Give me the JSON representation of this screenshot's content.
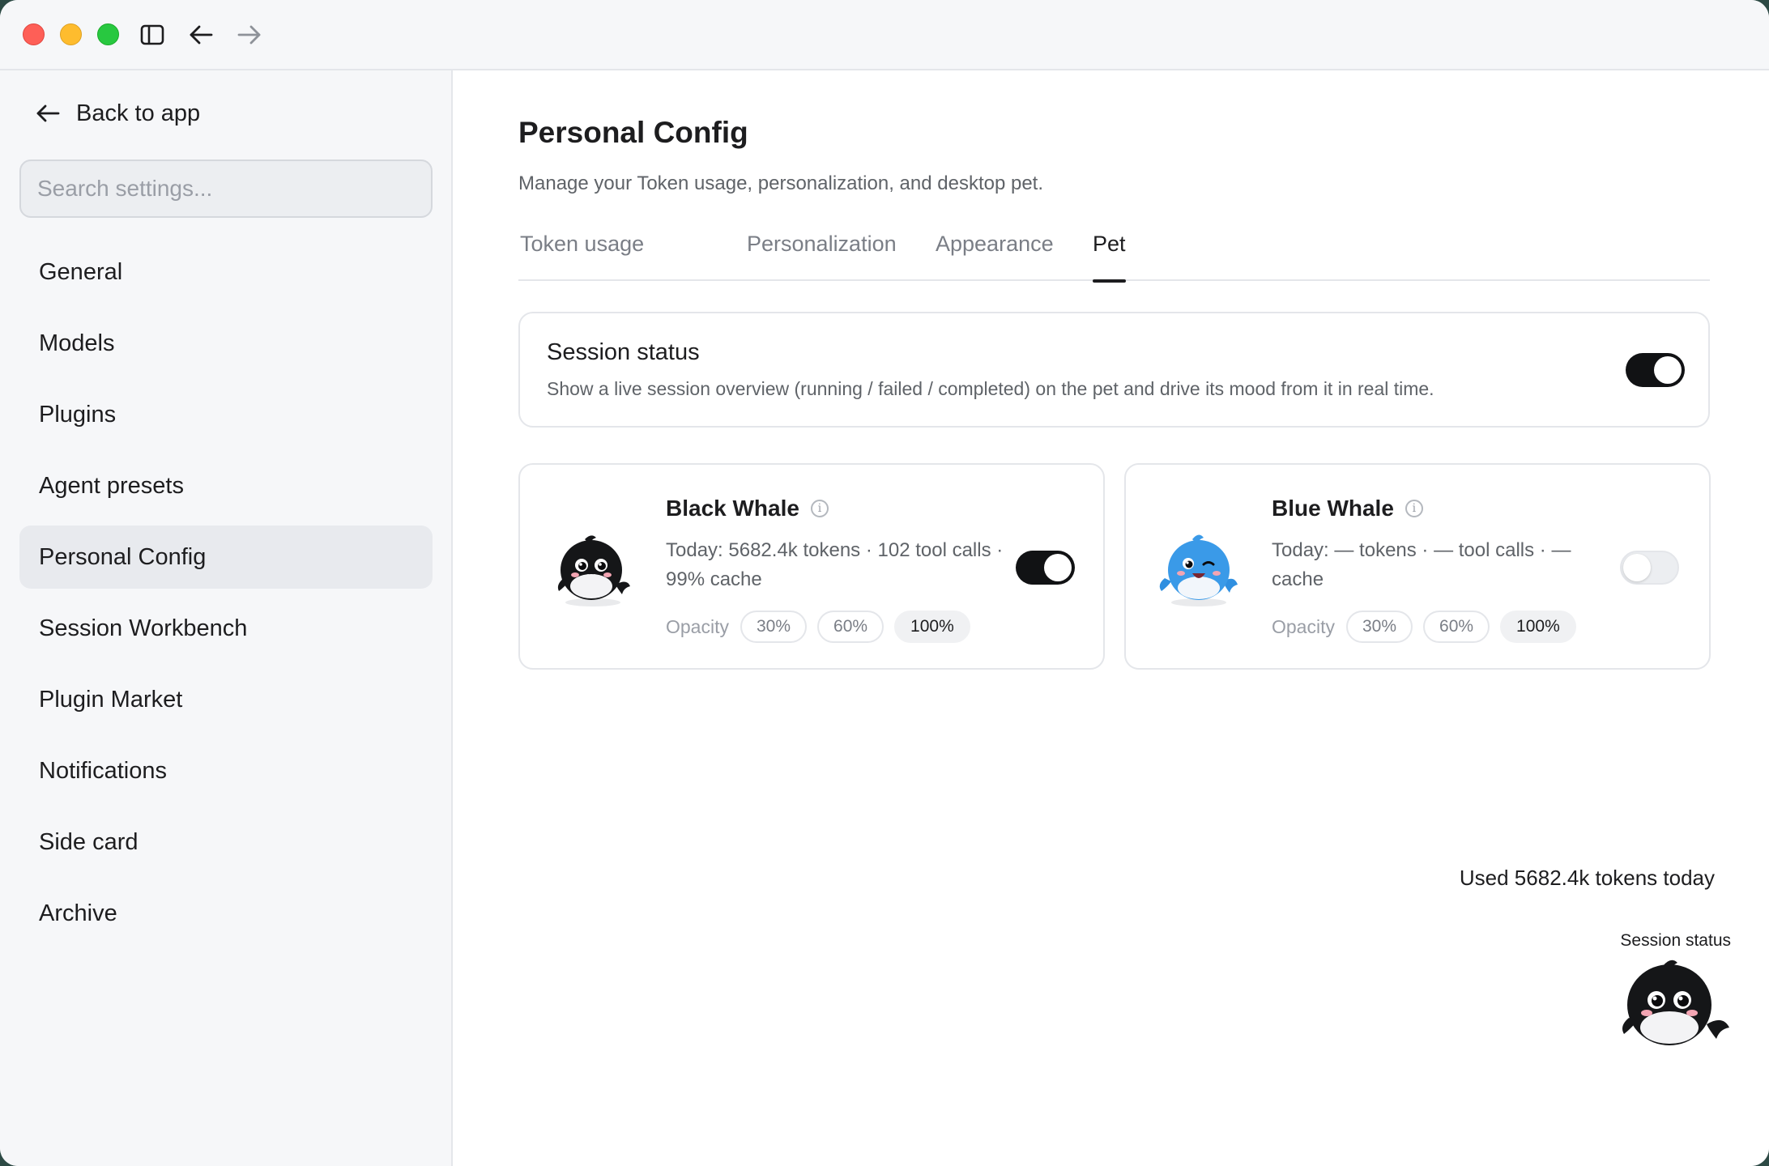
{
  "titlebar": {
    "icons": [
      "sidebar-toggle-icon",
      "arrow-left-icon",
      "arrow-right-icon"
    ]
  },
  "sidebar": {
    "back_label": "Back to app",
    "search_placeholder": "Search settings...",
    "items": [
      {
        "label": "General"
      },
      {
        "label": "Models"
      },
      {
        "label": "Plugins"
      },
      {
        "label": "Agent presets"
      },
      {
        "label": "Personal Config",
        "active": true
      },
      {
        "label": "Session Workbench"
      },
      {
        "label": "Plugin Market"
      },
      {
        "label": "Notifications"
      },
      {
        "label": "Side card"
      },
      {
        "label": "Archive"
      }
    ]
  },
  "main": {
    "title": "Personal Config",
    "subtitle": "Manage your Token usage, personalization, and desktop pet.",
    "tabs": [
      {
        "label": "Token usage"
      },
      {
        "label": "Personalization"
      },
      {
        "label": "Appearance"
      },
      {
        "label": "Pet",
        "active": true
      }
    ],
    "session_status": {
      "title": "Session status",
      "description": "Show a live session overview (running / failed / completed) on the pet and drive its mood from it in real time.",
      "enabled": true
    },
    "pets": [
      {
        "name": "Black Whale",
        "stats": "Today: 5682.4k tokens · 102 tool calls · 99% cache",
        "opacity_label": "Opacity",
        "opacity_options": [
          "30%",
          "60%",
          "100%"
        ],
        "opacity_selected": "100%",
        "enabled": true,
        "color": "#111214"
      },
      {
        "name": "Blue Whale",
        "stats": "Today: — tokens · — tool calls · — cache",
        "opacity_label": "Opacity",
        "opacity_options": [
          "30%",
          "60%",
          "100%"
        ],
        "opacity_selected": "100%",
        "enabled": false,
        "color": "#2f8fe0"
      }
    ],
    "usage_text": "Used 5682.4k tokens today",
    "floating_pet_label": "Session status"
  },
  "colors": {
    "accent": "#111214",
    "sidebar_bg": "#f6f7f9",
    "active_item_bg": "#e8eaee",
    "close": "#fe5f57",
    "minimize": "#febc2e",
    "zoom": "#28c840"
  }
}
